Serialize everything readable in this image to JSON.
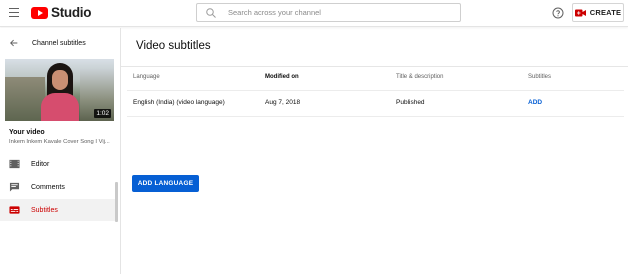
{
  "header": {
    "logo_text": "Studio",
    "search_placeholder": "Search across your channel",
    "create_label": "CREATE",
    "brand_color": "#ff0000"
  },
  "sidebar": {
    "back_label": "Channel subtitles",
    "thumbnail_duration": "1:02",
    "your_video_label": "Your video",
    "video_title": "Inkem Inkem Kavale Cover Song I Vij...",
    "nav_items": [
      {
        "label": "Editor",
        "icon": "film-icon",
        "active": false
      },
      {
        "label": "Comments",
        "icon": "comment-icon",
        "active": false
      },
      {
        "label": "Subtitles",
        "icon": "subtitles-icon",
        "active": true
      }
    ]
  },
  "main": {
    "title": "Video subtitles",
    "columns": [
      "Language",
      "Modified on",
      "Title & description",
      "Subtitles"
    ],
    "rows": [
      {
        "language": "English (India) (video language)",
        "modified": "Aug 7, 2018",
        "title_desc": "Published",
        "subtitles": "ADD"
      }
    ],
    "add_language_label": "ADD LANGUAGE",
    "accent_color": "#065fd4"
  }
}
